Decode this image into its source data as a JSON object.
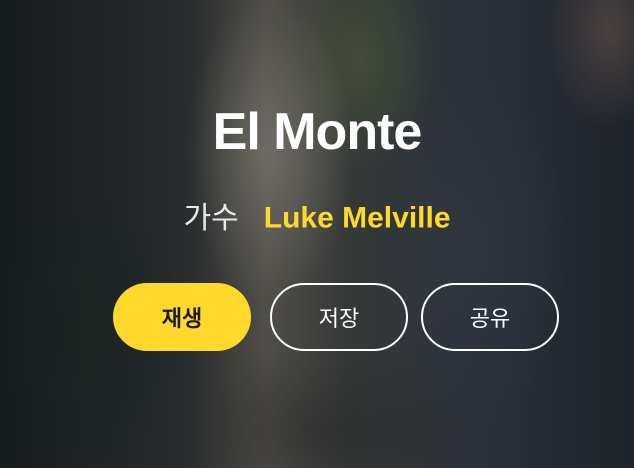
{
  "track": {
    "title": "El Monte",
    "artist_label": "가수",
    "artist_name": "Luke Melville"
  },
  "actions": {
    "play_label": "재생",
    "save_label": "저장",
    "share_label": "공유"
  },
  "colors": {
    "accent": "#ffd82c",
    "text": "#ffffff"
  }
}
